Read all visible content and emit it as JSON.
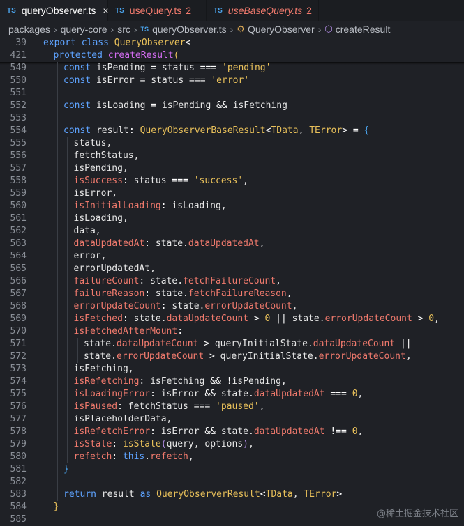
{
  "tabs": [
    {
      "icon": "TS",
      "name": "queryObserver.ts",
      "count": "",
      "close": "×",
      "active": true
    },
    {
      "icon": "TS",
      "name": "useQuery.ts",
      "count": "2",
      "close": "",
      "active": false
    },
    {
      "icon": "TS",
      "name": "useBaseQuery.ts",
      "count": "2",
      "close": "",
      "active": false
    }
  ],
  "breadcrumb": {
    "parts": [
      "packages",
      "query-core",
      "src"
    ],
    "file_icon": "TS",
    "file": "queryObserver.ts",
    "class": "QueryObserver",
    "method": "createResult",
    "sep": "›"
  },
  "lines": [
    {
      "n": "39",
      "indent": 0,
      "tokens": [
        [
          "kw",
          "export"
        ],
        [
          "var",
          " "
        ],
        [
          "kw",
          "class"
        ],
        [
          "var",
          " "
        ],
        [
          "cls",
          "QueryObserver"
        ],
        [
          "op",
          "<"
        ]
      ]
    },
    {
      "n": "421",
      "indent": 1,
      "tokens": [
        [
          "kw",
          "protected"
        ],
        [
          "var",
          " "
        ],
        [
          "fn",
          "createResult"
        ],
        [
          "br1",
          "("
        ]
      ]
    },
    {
      "n": "549",
      "indent": 2,
      "tokens": [
        [
          "kw",
          "const"
        ],
        [
          "var",
          " isPending "
        ],
        [
          "op",
          "="
        ],
        [
          "var",
          " status "
        ],
        [
          "op",
          "==="
        ],
        [
          "var",
          " "
        ],
        [
          "str",
          "'pending'"
        ]
      ]
    },
    {
      "n": "550",
      "indent": 2,
      "tokens": [
        [
          "kw",
          "const"
        ],
        [
          "var",
          " isError "
        ],
        [
          "op",
          "="
        ],
        [
          "var",
          " status "
        ],
        [
          "op",
          "==="
        ],
        [
          "var",
          " "
        ],
        [
          "str",
          "'error'"
        ]
      ]
    },
    {
      "n": "551",
      "indent": 2,
      "tokens": []
    },
    {
      "n": "552",
      "indent": 2,
      "tokens": [
        [
          "kw",
          "const"
        ],
        [
          "var",
          " isLoading "
        ],
        [
          "op",
          "="
        ],
        [
          "var",
          " isPending "
        ],
        [
          "op",
          "&&"
        ],
        [
          "var",
          " isFetching"
        ]
      ]
    },
    {
      "n": "553",
      "indent": 2,
      "tokens": []
    },
    {
      "n": "554",
      "indent": 2,
      "tokens": [
        [
          "kw",
          "const"
        ],
        [
          "var",
          " result"
        ],
        [
          "op",
          ":"
        ],
        [
          "var",
          " "
        ],
        [
          "type",
          "QueryObserverBaseResult"
        ],
        [
          "op",
          "<"
        ],
        [
          "type",
          "TData"
        ],
        [
          "var",
          ", "
        ],
        [
          "type",
          "TError"
        ],
        [
          "op",
          "> ="
        ],
        [
          "var",
          " "
        ],
        [
          "br3",
          "{"
        ]
      ]
    },
    {
      "n": "555",
      "indent": 3,
      "tokens": [
        [
          "var",
          "status,"
        ]
      ]
    },
    {
      "n": "556",
      "indent": 3,
      "tokens": [
        [
          "var",
          "fetchStatus,"
        ]
      ]
    },
    {
      "n": "557",
      "indent": 3,
      "tokens": [
        [
          "var",
          "isPending,"
        ]
      ]
    },
    {
      "n": "558",
      "indent": 3,
      "tokens": [
        [
          "prop",
          "isSuccess"
        ],
        [
          "op",
          ":"
        ],
        [
          "var",
          " status "
        ],
        [
          "op",
          "==="
        ],
        [
          "var",
          " "
        ],
        [
          "str",
          "'success'"
        ],
        [
          "var",
          ","
        ]
      ]
    },
    {
      "n": "559",
      "indent": 3,
      "tokens": [
        [
          "var",
          "isError,"
        ]
      ]
    },
    {
      "n": "560",
      "indent": 3,
      "tokens": [
        [
          "prop",
          "isInitialLoading"
        ],
        [
          "op",
          ":"
        ],
        [
          "var",
          " isLoading,"
        ]
      ]
    },
    {
      "n": "561",
      "indent": 3,
      "tokens": [
        [
          "var",
          "isLoading,"
        ]
      ]
    },
    {
      "n": "562",
      "indent": 3,
      "tokens": [
        [
          "var",
          "data,"
        ]
      ]
    },
    {
      "n": "563",
      "indent": 3,
      "tokens": [
        [
          "prop",
          "dataUpdatedAt"
        ],
        [
          "op",
          ":"
        ],
        [
          "var",
          " state."
        ],
        [
          "prop",
          "dataUpdatedAt"
        ],
        [
          "var",
          ","
        ]
      ]
    },
    {
      "n": "564",
      "indent": 3,
      "tokens": [
        [
          "var",
          "error,"
        ]
      ]
    },
    {
      "n": "565",
      "indent": 3,
      "tokens": [
        [
          "var",
          "errorUpdatedAt,"
        ]
      ]
    },
    {
      "n": "566",
      "indent": 3,
      "tokens": [
        [
          "prop",
          "failureCount"
        ],
        [
          "op",
          ":"
        ],
        [
          "var",
          " state."
        ],
        [
          "prop",
          "fetchFailureCount"
        ],
        [
          "var",
          ","
        ]
      ]
    },
    {
      "n": "567",
      "indent": 3,
      "tokens": [
        [
          "prop",
          "failureReason"
        ],
        [
          "op",
          ":"
        ],
        [
          "var",
          " state."
        ],
        [
          "prop",
          "fetchFailureReason"
        ],
        [
          "var",
          ","
        ]
      ]
    },
    {
      "n": "568",
      "indent": 3,
      "tokens": [
        [
          "prop",
          "errorUpdateCount"
        ],
        [
          "op",
          ":"
        ],
        [
          "var",
          " state."
        ],
        [
          "prop",
          "errorUpdateCount"
        ],
        [
          "var",
          ","
        ]
      ]
    },
    {
      "n": "569",
      "indent": 3,
      "tokens": [
        [
          "prop",
          "isFetched"
        ],
        [
          "op",
          ":"
        ],
        [
          "var",
          " state."
        ],
        [
          "prop",
          "dataUpdateCount"
        ],
        [
          "var",
          " "
        ],
        [
          "op",
          ">"
        ],
        [
          "var",
          " "
        ],
        [
          "num",
          "0"
        ],
        [
          "var",
          " "
        ],
        [
          "op",
          "||"
        ],
        [
          "var",
          " state."
        ],
        [
          "prop",
          "errorUpdateCount"
        ],
        [
          "var",
          " "
        ],
        [
          "op",
          ">"
        ],
        [
          "var",
          " "
        ],
        [
          "num",
          "0"
        ],
        [
          "var",
          ","
        ]
      ]
    },
    {
      "n": "570",
      "indent": 3,
      "tokens": [
        [
          "prop",
          "isFetchedAfterMount"
        ],
        [
          "op",
          ":"
        ]
      ]
    },
    {
      "n": "571",
      "indent": 4,
      "tokens": [
        [
          "var",
          "state."
        ],
        [
          "prop",
          "dataUpdateCount"
        ],
        [
          "var",
          " "
        ],
        [
          "op",
          ">"
        ],
        [
          "var",
          " queryInitialState."
        ],
        [
          "prop",
          "dataUpdateCount"
        ],
        [
          "var",
          " "
        ],
        [
          "op",
          "||"
        ]
      ]
    },
    {
      "n": "572",
      "indent": 4,
      "tokens": [
        [
          "var",
          "state."
        ],
        [
          "prop",
          "errorUpdateCount"
        ],
        [
          "var",
          " "
        ],
        [
          "op",
          ">"
        ],
        [
          "var",
          " queryInitialState."
        ],
        [
          "prop",
          "errorUpdateCount"
        ],
        [
          "var",
          ","
        ]
      ]
    },
    {
      "n": "573",
      "indent": 3,
      "tokens": [
        [
          "var",
          "isFetching,"
        ]
      ]
    },
    {
      "n": "574",
      "indent": 3,
      "tokens": [
        [
          "prop",
          "isRefetching"
        ],
        [
          "op",
          ":"
        ],
        [
          "var",
          " isFetching "
        ],
        [
          "op",
          "&&"
        ],
        [
          "var",
          " "
        ],
        [
          "op",
          "!"
        ],
        [
          "var",
          "isPending,"
        ]
      ]
    },
    {
      "n": "575",
      "indent": 3,
      "tokens": [
        [
          "prop",
          "isLoadingError"
        ],
        [
          "op",
          ":"
        ],
        [
          "var",
          " isError "
        ],
        [
          "op",
          "&&"
        ],
        [
          "var",
          " state."
        ],
        [
          "prop",
          "dataUpdatedAt"
        ],
        [
          "var",
          " "
        ],
        [
          "op",
          "==="
        ],
        [
          "var",
          " "
        ],
        [
          "num",
          "0"
        ],
        [
          "var",
          ","
        ]
      ]
    },
    {
      "n": "576",
      "indent": 3,
      "tokens": [
        [
          "prop",
          "isPaused"
        ],
        [
          "op",
          ":"
        ],
        [
          "var",
          " fetchStatus "
        ],
        [
          "op",
          "==="
        ],
        [
          "var",
          " "
        ],
        [
          "str",
          "'paused'"
        ],
        [
          "var",
          ","
        ]
      ]
    },
    {
      "n": "577",
      "indent": 3,
      "tokens": [
        [
          "var",
          "isPlaceholderData,"
        ]
      ]
    },
    {
      "n": "578",
      "indent": 3,
      "tokens": [
        [
          "prop",
          "isRefetchError"
        ],
        [
          "op",
          ":"
        ],
        [
          "var",
          " isError "
        ],
        [
          "op",
          "&&"
        ],
        [
          "var",
          " state."
        ],
        [
          "prop",
          "dataUpdatedAt"
        ],
        [
          "var",
          " "
        ],
        [
          "op",
          "!=="
        ],
        [
          "var",
          " "
        ],
        [
          "num",
          "0"
        ],
        [
          "var",
          ","
        ]
      ]
    },
    {
      "n": "579",
      "indent": 3,
      "tokens": [
        [
          "prop",
          "isStale"
        ],
        [
          "op",
          ":"
        ],
        [
          "var",
          " "
        ],
        [
          "cls",
          "isStale"
        ],
        [
          "br2",
          "("
        ],
        [
          "var",
          "query, options"
        ],
        [
          "br2",
          ")"
        ],
        [
          "var",
          ","
        ]
      ]
    },
    {
      "n": "580",
      "indent": 3,
      "tokens": [
        [
          "prop",
          "refetch"
        ],
        [
          "op",
          ":"
        ],
        [
          "var",
          " "
        ],
        [
          "kw",
          "this"
        ],
        [
          "var",
          "."
        ],
        [
          "prop",
          "refetch"
        ],
        [
          "var",
          ","
        ]
      ]
    },
    {
      "n": "581",
      "indent": 2,
      "tokens": [
        [
          "br3",
          "}"
        ]
      ]
    },
    {
      "n": "582",
      "indent": 2,
      "tokens": []
    },
    {
      "n": "583",
      "indent": 2,
      "tokens": [
        [
          "kw",
          "return"
        ],
        [
          "var",
          " result "
        ],
        [
          "kw",
          "as"
        ],
        [
          "var",
          " "
        ],
        [
          "type",
          "QueryObserverResult"
        ],
        [
          "op",
          "<"
        ],
        [
          "type",
          "TData"
        ],
        [
          "var",
          ", "
        ],
        [
          "type",
          "TError"
        ],
        [
          "op",
          ">"
        ]
      ]
    },
    {
      "n": "584",
      "indent": 1,
      "tokens": [
        [
          "br1",
          "}"
        ]
      ]
    },
    {
      "n": "585",
      "indent": 0,
      "tokens": []
    }
  ],
  "watermark": "@稀土掘金技术社区",
  "colors": {
    "background": "#1f2126",
    "keyword": "#5ea3ff",
    "type": "#e8c05a",
    "property": "#f07a6d",
    "function": "#d26cf0"
  }
}
